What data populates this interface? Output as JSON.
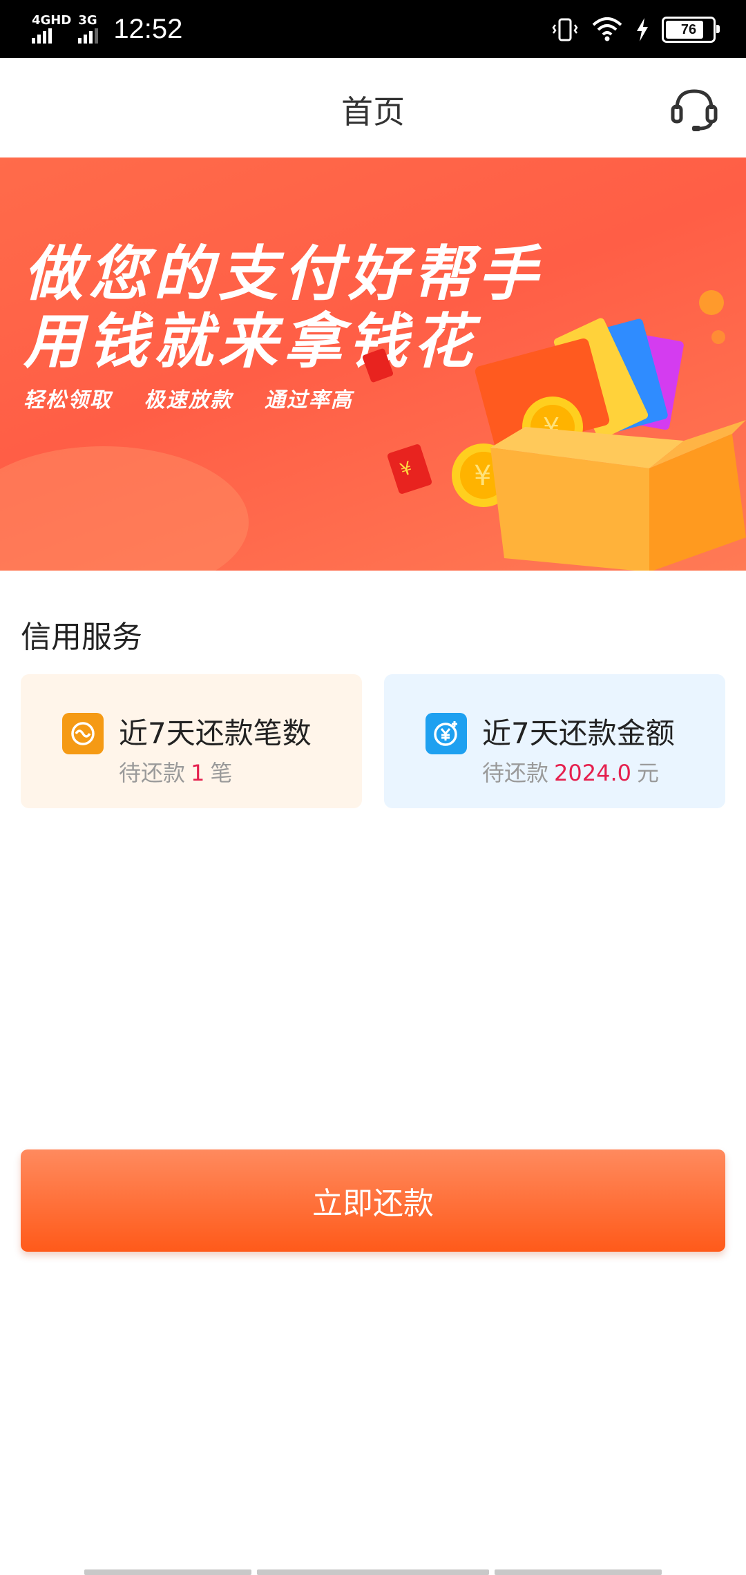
{
  "status_bar": {
    "network1": "4GHD",
    "network2": "3G",
    "time": "12:52",
    "battery": "76"
  },
  "header": {
    "title": "首页",
    "service_icon": "headset-icon"
  },
  "banner": {
    "line1": "做您的支付好帮手",
    "line2": "用钱就来拿钱花",
    "tags": [
      "轻松领取",
      "极速放款",
      "通过率高"
    ]
  },
  "credit": {
    "section_title": "信用服务",
    "count_card": {
      "icon": "repayment-count-icon",
      "title": "近7天还款笔数",
      "prefix": "待还款",
      "value": "1",
      "unit": "笔"
    },
    "amount_card": {
      "icon": "yuan-amount-icon",
      "title": "近7天还款金额",
      "prefix": "待还款",
      "value": "2024.0",
      "unit": "元"
    }
  },
  "actions": {
    "repay_button": "立即还款"
  },
  "colors": {
    "accent": "#ff5a1a",
    "highlight_number": "#e5204e",
    "banner": "#ff6b4a"
  }
}
